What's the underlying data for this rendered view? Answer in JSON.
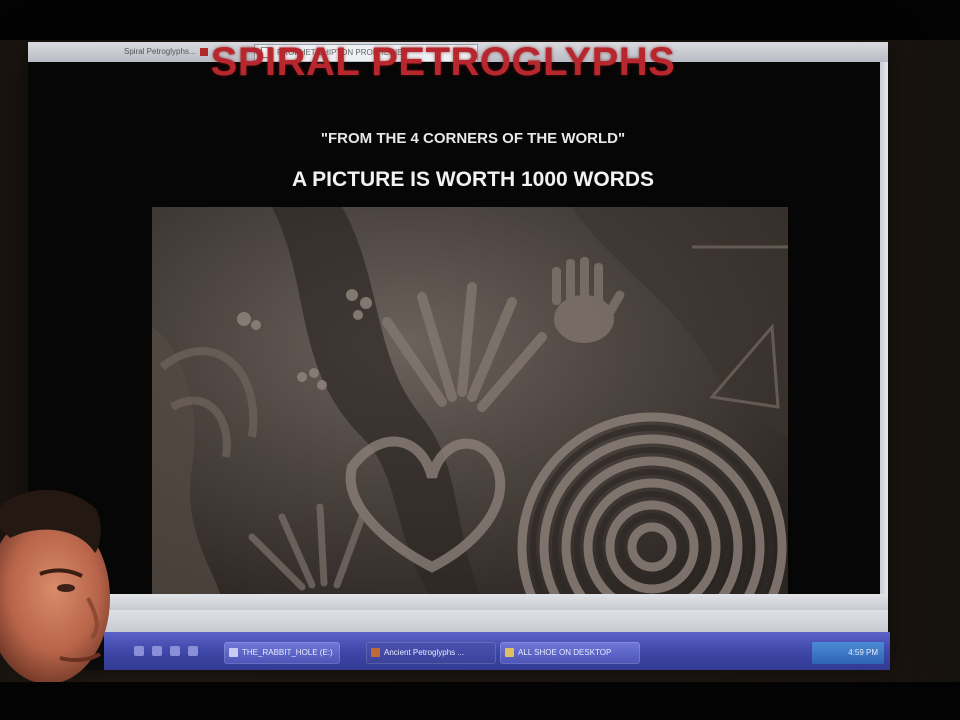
{
  "browser": {
    "tabs": [
      {
        "label": "Spiral Petroglyphs..."
      },
      {
        "label": "PROPHET SHIPTON PROPHECIES"
      }
    ]
  },
  "page": {
    "title": "SPIRAL PETROGLYPHS",
    "subtitle": "\"FROM THE 4 CORNERS OF THE WORLD\"",
    "tagline": "A PICTURE IS WORTH 1000 WORDS"
  },
  "taskbar": {
    "tasks": [
      {
        "label": "THE_RABBIT_HOLE (E:)"
      },
      {
        "label": "Ancient Petroglyphs ..."
      },
      {
        "label": "ALL SHOE ON DESKTOP"
      }
    ],
    "clock": "4:59 PM"
  },
  "colors": {
    "title": "#b8262e",
    "taskbar": "#3f47a8",
    "page_background": "#070606"
  }
}
